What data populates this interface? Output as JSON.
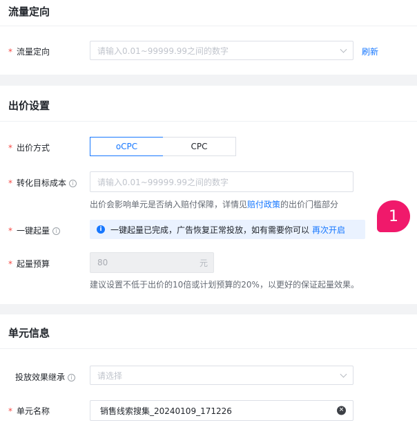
{
  "traffic": {
    "title": "流量定向",
    "label": "流量定向",
    "placeholder": "请输入0.01~99999.99之间的数字",
    "refresh": "刷新"
  },
  "bid": {
    "title": "出价设置",
    "method_label": "出价方式",
    "methods": [
      "oCPC",
      "CPC"
    ],
    "selected_method": "oCPC",
    "cost_label": "转化目标成本",
    "cost_placeholder": "请输入0.01~99999.99之间的数字",
    "cost_hint_pre": "出价会影响单元是否纳入赔付保障，详情见",
    "cost_hint_link": "赔付政策",
    "cost_hint_post": "的出价门槛部分",
    "boost_label": "一键起量",
    "boost_banner": "一键起量已完成，广告恢复正常投放，如有需要你可以",
    "boost_banner_link": "再次开启",
    "budget_label": "起量预算",
    "budget_value": "80",
    "budget_unit": "元",
    "budget_hint": "建议设置不低于出价的10倍或计划预算的20%，以更好的保证起量效果。"
  },
  "unit": {
    "title": "单元信息",
    "inherit_label": "投放效果继承",
    "inherit_placeholder": "请选择",
    "name_label": "单元名称",
    "name_value": "销售线索搜集_20240109_171226"
  },
  "badge": "1",
  "colors": {
    "accent": "#1677ff",
    "required": "#f54a45",
    "badge": "#f0196b"
  }
}
